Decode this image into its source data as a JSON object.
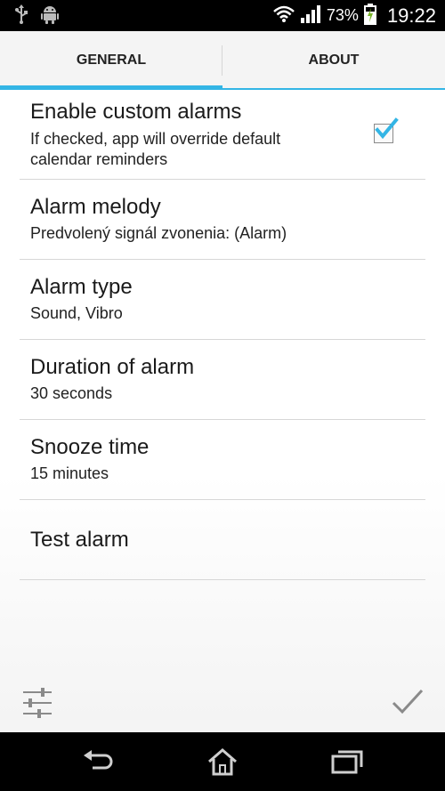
{
  "status_bar": {
    "battery_text": "73%",
    "time": "19:22",
    "icons": [
      "usb-icon",
      "android-icon",
      "wifi-icon",
      "signal-icon",
      "battery-charging-icon"
    ]
  },
  "tabs": [
    {
      "label": "GENERAL",
      "selected": true
    },
    {
      "label": "ABOUT",
      "selected": false
    }
  ],
  "preferences": [
    {
      "title": "Enable custom alarms",
      "summary_line1": "If checked, app will override default",
      "summary_line2": "calendar reminders",
      "checked": true
    },
    {
      "title": "Alarm melody",
      "summary": "Predvolený signál zvonenia: (Alarm)"
    },
    {
      "title": "Alarm type",
      "summary": "Sound, Vibro"
    },
    {
      "title": "Duration of alarm",
      "summary": "30 seconds"
    },
    {
      "title": "Snooze time",
      "summary": "15 minutes"
    },
    {
      "title": "Test alarm"
    }
  ],
  "colors": {
    "accent": "#33b5e5",
    "status_bar": "#000000",
    "nav_bar": "#000000"
  },
  "bottom_actions": {
    "left_icon": "sliders-icon",
    "right_icon": "checkmark-icon"
  },
  "nav_bar": {
    "icons": [
      "back-icon",
      "home-icon",
      "recent-apps-icon"
    ]
  }
}
